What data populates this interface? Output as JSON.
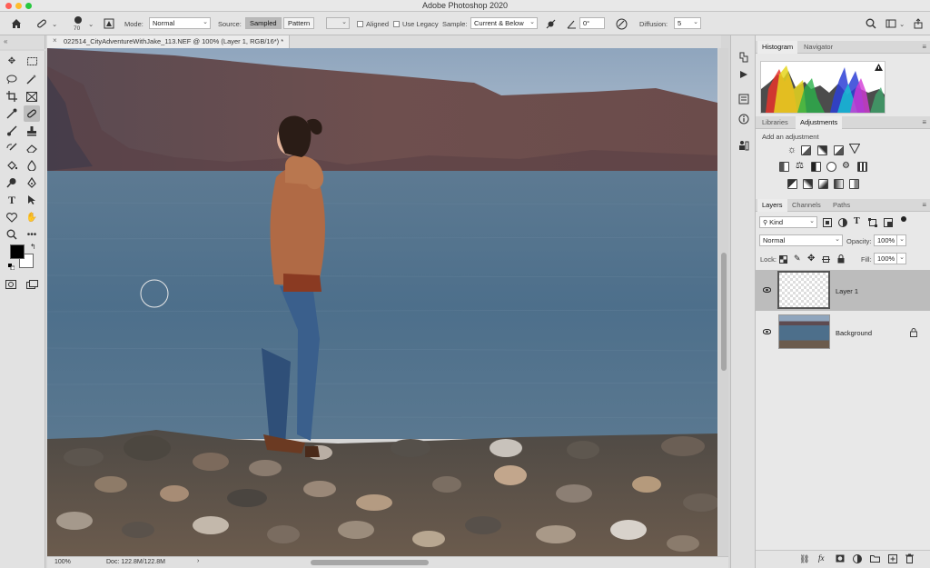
{
  "window": {
    "title": "Adobe Photoshop 2020"
  },
  "options": {
    "brush_size": "70",
    "mode_label": "Mode:",
    "mode_value": "Normal",
    "source_label": "Source:",
    "source_options": [
      "Sampled",
      "Pattern"
    ],
    "aligned_label": "Aligned",
    "legacy_label": "Use Legacy",
    "sample_label": "Sample:",
    "sample_value": "Current & Below",
    "angle_value": "0°",
    "diffusion_label": "Diffusion:",
    "diffusion_value": "5"
  },
  "document": {
    "tab_title": "022514_CityAdventureWithJake_113.NEF @ 100% (Layer 1, RGB/16*) *",
    "close_glyph": "×"
  },
  "status": {
    "zoom": "100%",
    "doc_info": "Doc: 122.8M/122.8M",
    "arrow": "›"
  },
  "panels": {
    "top_tabs": [
      "Histogram",
      "Navigator"
    ],
    "mid_tabs": [
      "Libraries",
      "Adjustments"
    ],
    "adjustments_hint": "Add an adjustment",
    "layer_tabs": [
      "Layers",
      "Channels",
      "Paths"
    ],
    "filter_kind": "Kind",
    "blend_mode": "Normal",
    "opacity_label": "Opacity:",
    "opacity_value": "100%",
    "lock_label": "Lock:",
    "fill_label": "Fill:",
    "fill_value": "100%",
    "layers": [
      {
        "name": "Layer 1"
      },
      {
        "name": "Background"
      }
    ]
  },
  "colors": {
    "accent": "#2f6fd6",
    "sea": "#4c6e88",
    "sky": "#9fb4c8"
  }
}
